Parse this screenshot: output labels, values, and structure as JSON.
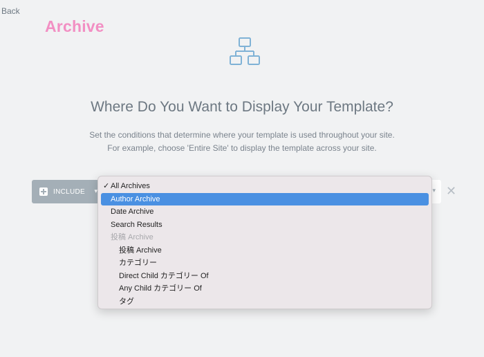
{
  "back_label": "Back",
  "brand": "Archive",
  "hero_icon": "sitemap-icon",
  "title": "Where Do You Want to Display Your Template?",
  "description": {
    "line1": "Set the conditions that determine where your template is used throughout your site.",
    "line2": "For example, choose 'Entire Site' to display the template across your site."
  },
  "condition": {
    "type_label": "INCLUDE",
    "type_icon": "plus-square-icon",
    "remove_icon": "close-icon"
  },
  "dropdown": {
    "options": [
      {
        "label": "All Archives",
        "checked": true,
        "selected": false,
        "disabled": false,
        "indent": 0
      },
      {
        "label": "Author Archive",
        "checked": false,
        "selected": true,
        "disabled": false,
        "indent": 0
      },
      {
        "label": "Date Archive",
        "checked": false,
        "selected": false,
        "disabled": false,
        "indent": 0
      },
      {
        "label": "Search Results",
        "checked": false,
        "selected": false,
        "disabled": false,
        "indent": 0
      },
      {
        "label": "投稿 Archive",
        "checked": false,
        "selected": false,
        "disabled": true,
        "indent": 0
      },
      {
        "label": "投稿 Archive",
        "checked": false,
        "selected": false,
        "disabled": false,
        "indent": 1
      },
      {
        "label": "カテゴリー",
        "checked": false,
        "selected": false,
        "disabled": false,
        "indent": 1
      },
      {
        "label": "Direct Child カテゴリー Of",
        "checked": false,
        "selected": false,
        "disabled": false,
        "indent": 1
      },
      {
        "label": "Any Child カテゴリー Of",
        "checked": false,
        "selected": false,
        "disabled": false,
        "indent": 1
      },
      {
        "label": "タグ",
        "checked": false,
        "selected": false,
        "disabled": false,
        "indent": 1
      }
    ]
  },
  "colors": {
    "brand": "#f28fc3",
    "selection": "#4a90e2",
    "include_bg": "#a4afb7"
  }
}
